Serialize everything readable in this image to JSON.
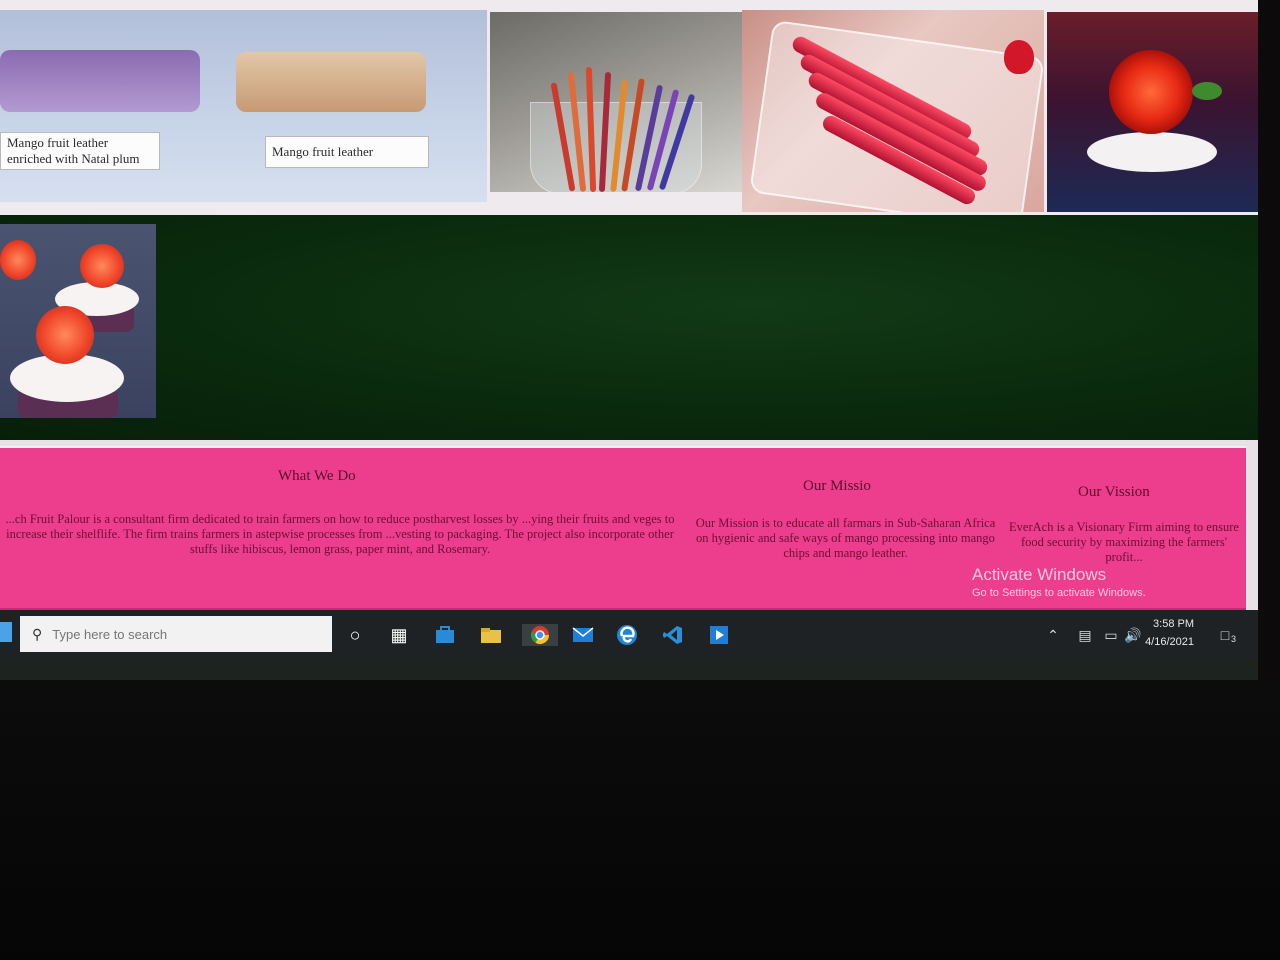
{
  "gallery": {
    "captions": {
      "natal_plum": "Mango fruit leather enriched with Natal plum",
      "mango": "Mango fruit leather"
    }
  },
  "info": {
    "what_we_do": {
      "title": "What We Do",
      "text": "...ch Fruit Palour is a consultant firm dedicated to train farmers on how to reduce postharvest losses by ...ying their fruits and veges to increase their shelflife. The firm trains farmers in astepwise processes from ...vesting to packaging. The project also incorporate other stuffs like hibiscus, lemon grass, paper mint, and Rosemary."
    },
    "mission": {
      "title": "Our Missio",
      "text": "Our Mission is to educate all farmars in Sub-Saharan Africa on hygienic and safe ways of mango processing into mango chips and mango leather."
    },
    "vision": {
      "title": "Our Vission",
      "text": "EverAch is a Visionary Firm aiming to ensure food security by maximizing the farmers' profit..."
    }
  },
  "watermark": {
    "title": "Activate Windows",
    "subtitle": "Go to Settings to activate Windows."
  },
  "taskbar": {
    "search_placeholder": "Type here to search",
    "time": "3:58 PM",
    "date": "4/16/2021",
    "notification_count": "3",
    "icons": [
      "cortana-icon",
      "task-view-icon",
      "store-icon",
      "file-explorer-icon",
      "chrome-icon",
      "mail-icon",
      "edge-icon",
      "vscode-icon",
      "media-player-icon"
    ]
  }
}
